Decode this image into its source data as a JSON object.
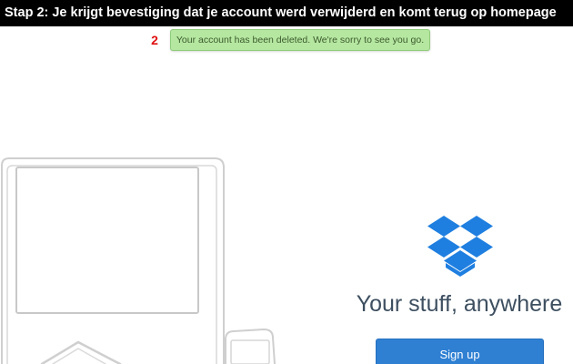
{
  "banner": {
    "text": "Stap 2:  Je krijgt bevestiging dat je account werd verwijderd en komt terug op homepage"
  },
  "step_marker": "2",
  "notice": {
    "message": "Your account has been deleted. We're sorry to see you go.",
    "color": "#b5e7a0"
  },
  "hero": {
    "illustration": "laptop-phone-sketch",
    "logo_icon": "dropbox-logo-icon",
    "tagline": "Your stuff, anywhere",
    "signup_label": "Sign up",
    "accent_color": "#2f80d3"
  }
}
